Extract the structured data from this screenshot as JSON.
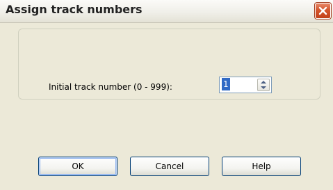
{
  "window": {
    "title": "Assign track numbers",
    "close_icon": "close-icon"
  },
  "form": {
    "label": "Initial track number (0 - 999):",
    "track_number": "1"
  },
  "buttons": {
    "ok": "OK",
    "cancel": "Cancel",
    "help": "Help"
  },
  "colors": {
    "close_button": "#d4562c",
    "selection": "#316ac5",
    "button_border": "#003c74"
  }
}
